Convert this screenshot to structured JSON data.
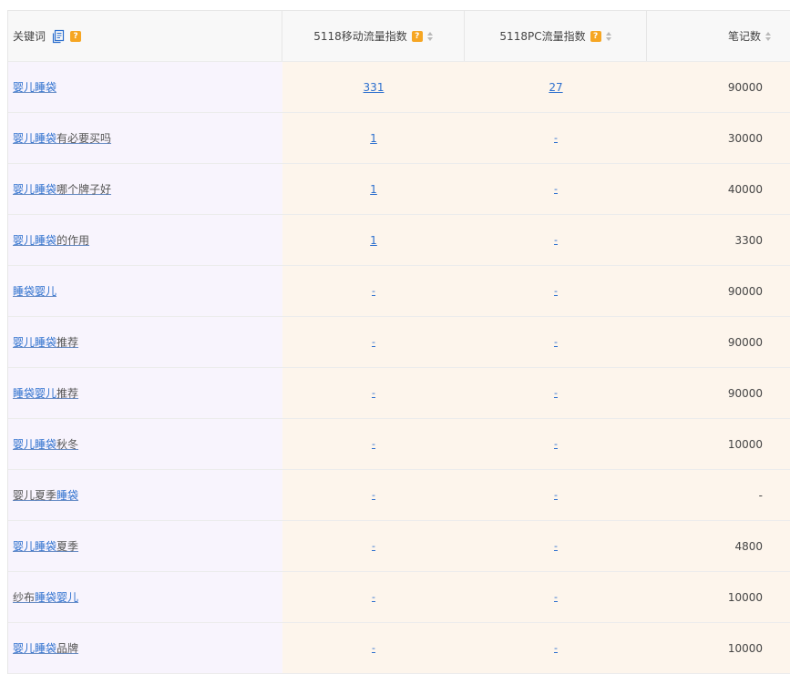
{
  "header": {
    "keyword": "关键词",
    "mobile_index": "5118移动流量指数",
    "pc_index": "5118PC流量指数",
    "notes": "笔记数",
    "help_icon_text": "?"
  },
  "rows": [
    {
      "kw_hl": "婴儿睡袋",
      "kw_rest": "",
      "mobile": "331",
      "pc": "27",
      "notes": "90000"
    },
    {
      "kw_hl": "婴儿睡袋",
      "kw_rest": "有必要买吗",
      "mobile": "1",
      "pc": "-",
      "notes": "30000"
    },
    {
      "kw_hl": "婴儿睡袋",
      "kw_rest": "哪个牌子好",
      "mobile": "1",
      "pc": "-",
      "notes": "40000"
    },
    {
      "kw_hl": "婴儿睡袋",
      "kw_rest": "的作用",
      "mobile": "1",
      "pc": "-",
      "notes": "3300"
    },
    {
      "kw_hl": "睡袋婴儿",
      "kw_rest": "",
      "mobile": "-",
      "pc": "-",
      "notes": "90000"
    },
    {
      "kw_hl": "婴儿睡袋",
      "kw_rest": "推荐",
      "mobile": "-",
      "pc": "-",
      "notes": "90000"
    },
    {
      "kw_hl": "睡袋婴儿",
      "kw_rest": "推荐",
      "mobile": "-",
      "pc": "-",
      "notes": "90000"
    },
    {
      "kw_hl": "婴儿睡袋",
      "kw_rest": "秋冬",
      "mobile": "-",
      "pc": "-",
      "notes": "10000"
    },
    {
      "kw_pre": "婴儿夏季",
      "kw_hl": "睡袋",
      "kw_rest": "",
      "mobile": "-",
      "pc": "-",
      "notes": "-"
    },
    {
      "kw_hl": "婴儿睡袋",
      "kw_rest": "夏季",
      "mobile": "-",
      "pc": "-",
      "notes": "4800"
    },
    {
      "kw_pre": "纱布",
      "kw_hl": "睡袋婴儿",
      "kw_rest": "",
      "mobile": "-",
      "pc": "-",
      "notes": "10000"
    },
    {
      "kw_hl": "婴儿睡袋",
      "kw_rest": "品牌",
      "mobile": "-",
      "pc": "-",
      "notes": "10000"
    }
  ],
  "colors": {
    "link": "#2c6fce",
    "help_badge": "#f6a623",
    "keyword_col_bg": "#f8f4fd",
    "data_col_bg": "#fdf5ec"
  }
}
